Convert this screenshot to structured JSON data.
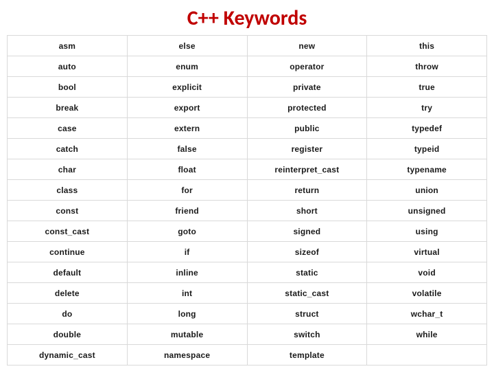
{
  "title": "C++ Keywords",
  "chart_data": {
    "type": "table",
    "columns": 4,
    "rows": [
      [
        "asm",
        "else",
        "new",
        "this"
      ],
      [
        "auto",
        "enum",
        "operator",
        "throw"
      ],
      [
        "bool",
        "explicit",
        "private",
        "true"
      ],
      [
        "break",
        "export",
        "protected",
        "try"
      ],
      [
        "case",
        "extern",
        "public",
        "typedef"
      ],
      [
        "catch",
        "false",
        "register",
        "typeid"
      ],
      [
        "char",
        "float",
        "reinterpret_cast",
        "typename"
      ],
      [
        "class",
        "for",
        "return",
        "union"
      ],
      [
        "const",
        "friend",
        "short",
        "unsigned"
      ],
      [
        "const_cast",
        "goto",
        "signed",
        "using"
      ],
      [
        "continue",
        "if",
        "sizeof",
        "virtual"
      ],
      [
        "default",
        "inline",
        "static",
        "void"
      ],
      [
        "delete",
        "int",
        "static_cast",
        "volatile"
      ],
      [
        "do",
        "long",
        "struct",
        "wchar_t"
      ],
      [
        "double",
        "mutable",
        "switch",
        "while"
      ],
      [
        "dynamic_cast",
        "namespace",
        "template",
        ""
      ]
    ]
  }
}
